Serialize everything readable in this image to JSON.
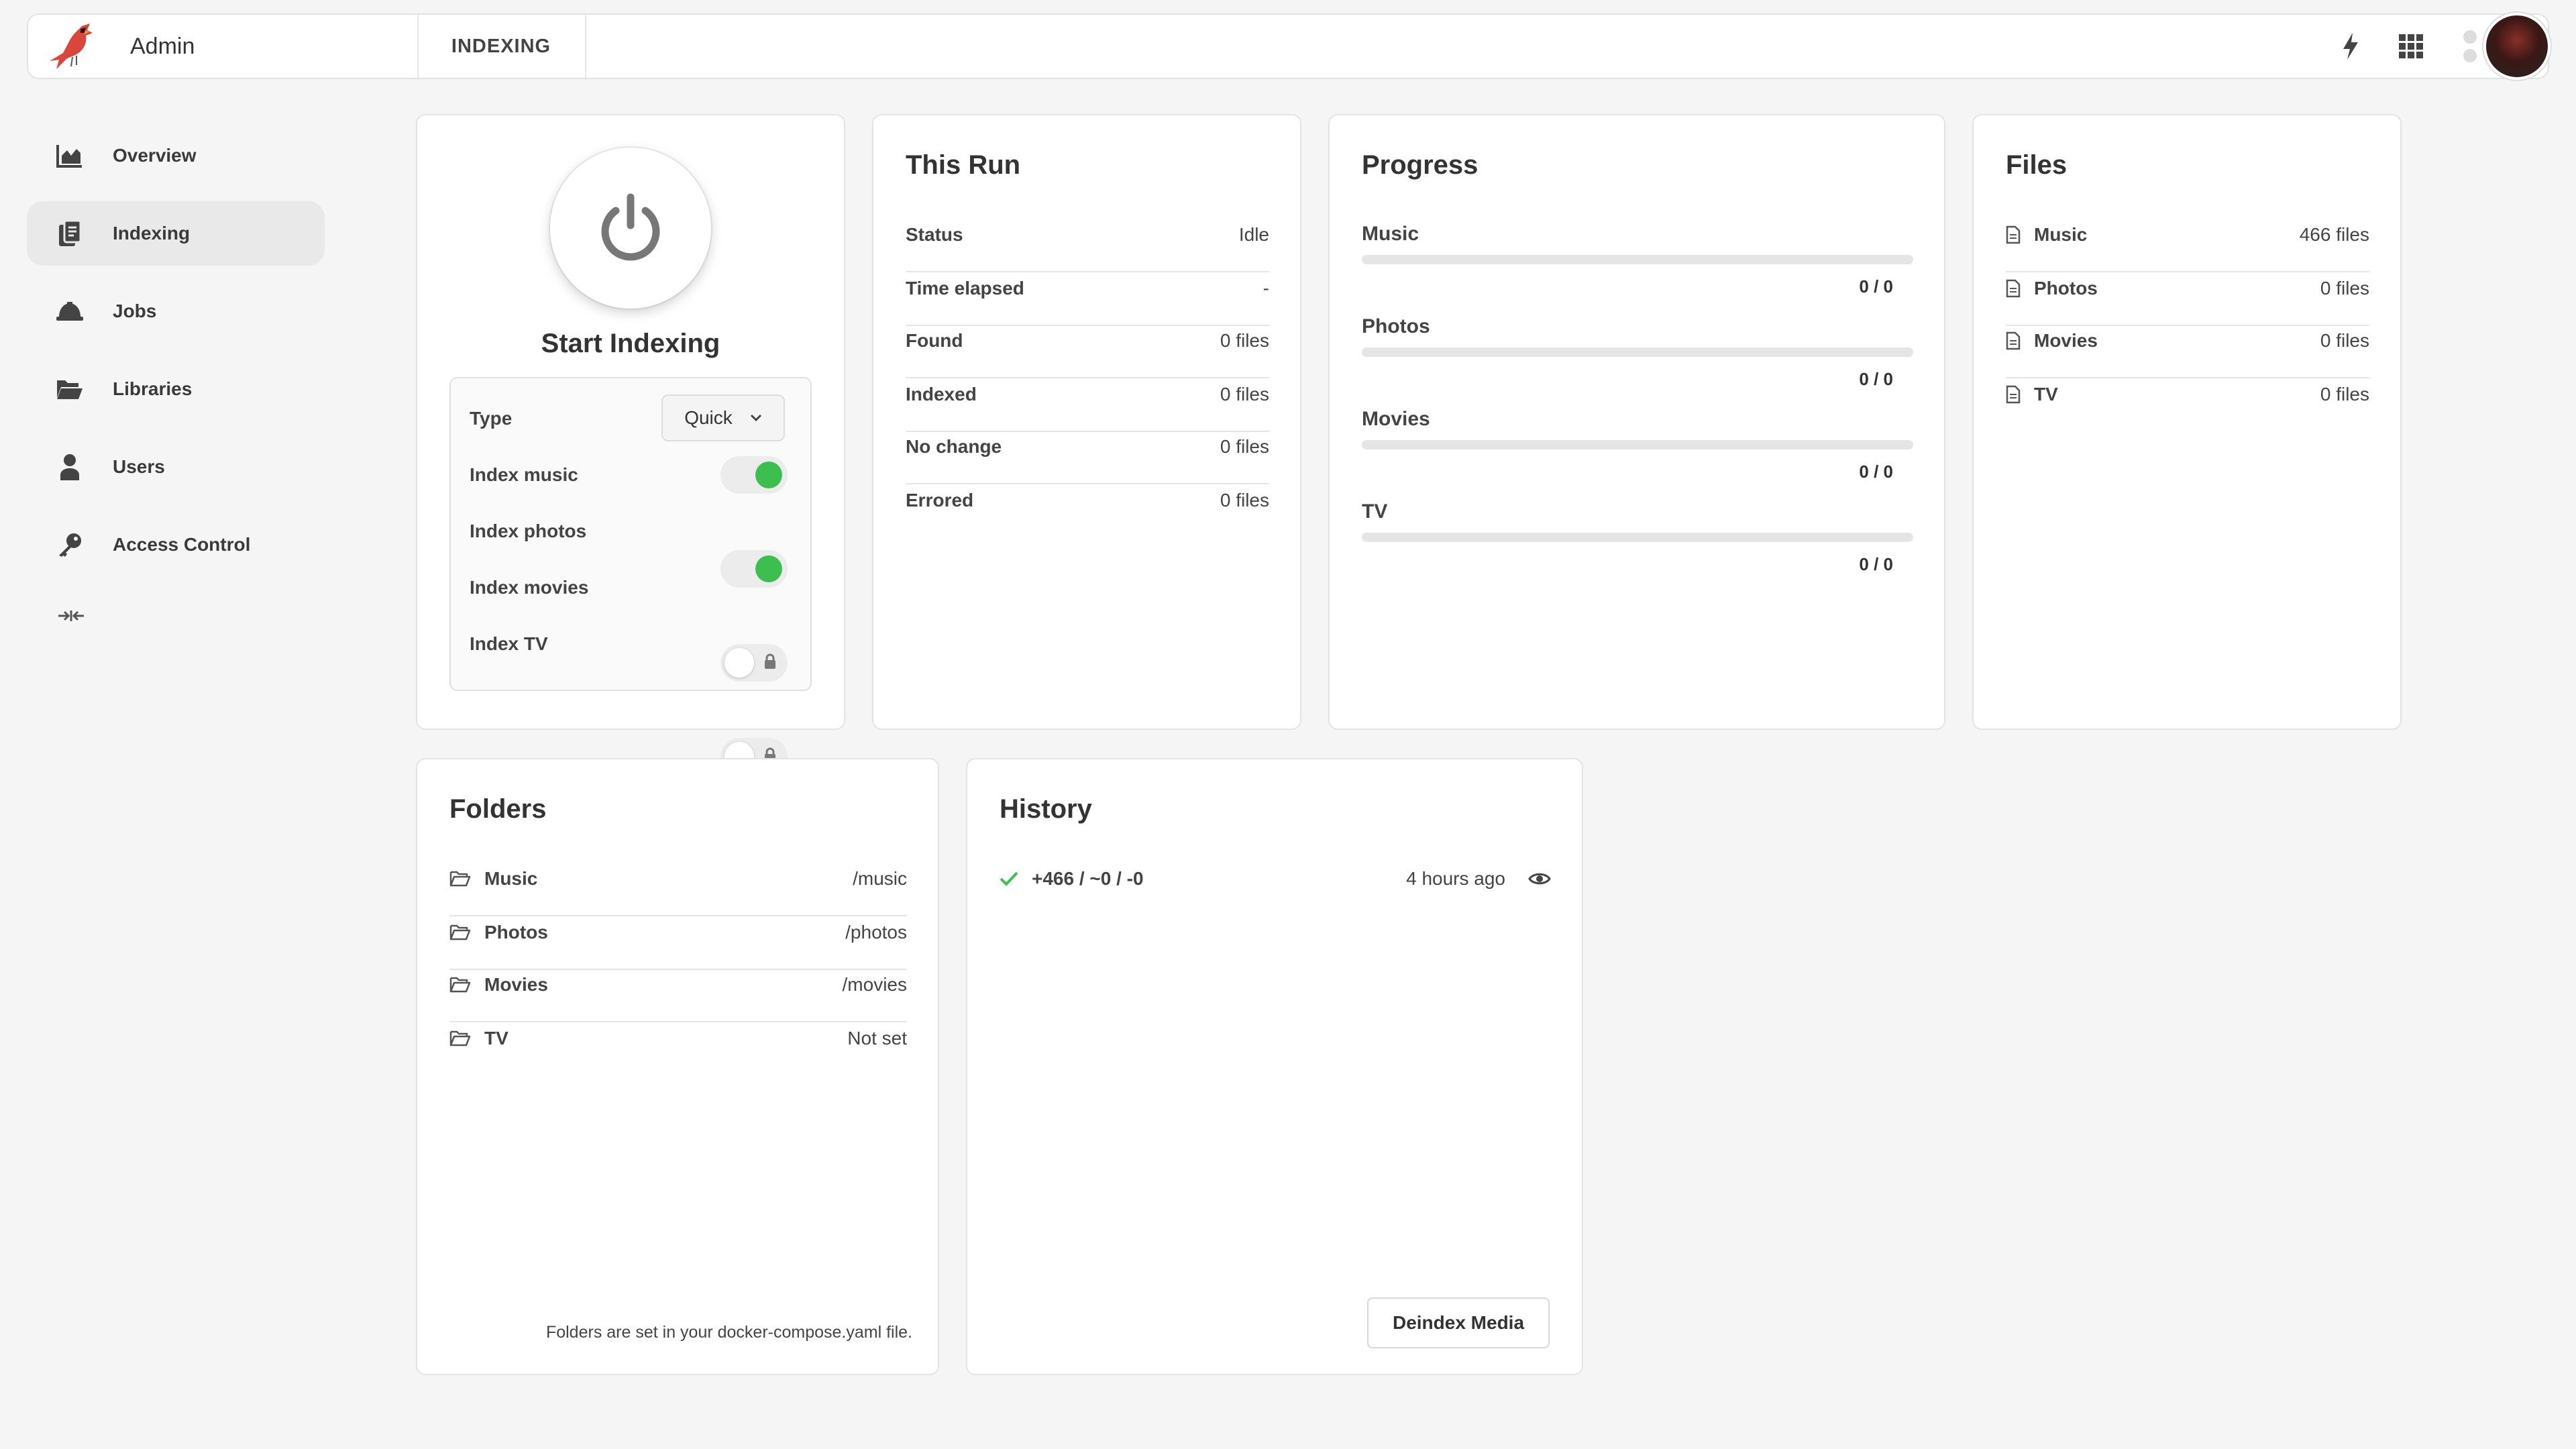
{
  "header": {
    "title": "Admin",
    "breadcrumb": "INDEXING",
    "icons": [
      "bolt-icon",
      "apps-grid-icon",
      "status-dots-icon"
    ]
  },
  "sidebar": {
    "items": [
      {
        "label": "Overview",
        "icon": "area-chart-icon"
      },
      {
        "label": "Indexing",
        "icon": "documents-icon",
        "active": true
      },
      {
        "label": "Jobs",
        "icon": "hard-hat-icon"
      },
      {
        "label": "Libraries",
        "icon": "folder-open-icon"
      },
      {
        "label": "Users",
        "icon": "user-icon"
      },
      {
        "label": "Access Control",
        "icon": "key-icon"
      }
    ],
    "collapse_icon": "collapse-arrows-icon"
  },
  "start": {
    "title": "Start Indexing",
    "type_label": "Type",
    "type_value": "Quick",
    "options": [
      {
        "label": "Index music",
        "on": true,
        "locked": false
      },
      {
        "label": "Index photos",
        "on": true,
        "locked": false
      },
      {
        "label": "Index movies",
        "on": false,
        "locked": true
      },
      {
        "label": "Index TV",
        "on": false,
        "locked": true
      }
    ]
  },
  "this_run": {
    "title": "This Run",
    "rows": [
      {
        "k": "Status",
        "v": "Idle"
      },
      {
        "k": "Time elapsed",
        "v": "-"
      },
      {
        "k": "Found",
        "v": "0 files"
      },
      {
        "k": "Indexed",
        "v": "0 files"
      },
      {
        "k": "No change",
        "v": "0 files"
      },
      {
        "k": "Errored",
        "v": "0 files"
      }
    ]
  },
  "progress": {
    "title": "Progress",
    "items": [
      {
        "label": "Music",
        "count": "0 / 0",
        "fraction": 0
      },
      {
        "label": "Photos",
        "count": "0 / 0",
        "fraction": 0
      },
      {
        "label": "Movies",
        "count": "0 / 0",
        "fraction": 0
      },
      {
        "label": "TV",
        "count": "0 / 0",
        "fraction": 0
      }
    ]
  },
  "files": {
    "title": "Files",
    "rows": [
      {
        "k": "Music",
        "v": "466 files"
      },
      {
        "k": "Photos",
        "v": "0 files"
      },
      {
        "k": "Movies",
        "v": "0 files"
      },
      {
        "k": "TV",
        "v": "0 files"
      }
    ]
  },
  "folders": {
    "title": "Folders",
    "rows": [
      {
        "k": "Music",
        "v": "/music"
      },
      {
        "k": "Photos",
        "v": "/photos"
      },
      {
        "k": "Movies",
        "v": "/movies"
      },
      {
        "k": "TV",
        "v": "Not set"
      }
    ],
    "note": "Folders are set in your docker-compose.yaml file."
  },
  "history": {
    "title": "History",
    "entries": [
      {
        "summary": "+466 / ~0 / -0",
        "time": "4 hours ago"
      }
    ],
    "deindex_label": "Deindex Media"
  },
  "colors": {
    "accent_green": "#3cbf4e",
    "brand_red": "#c0392b"
  }
}
